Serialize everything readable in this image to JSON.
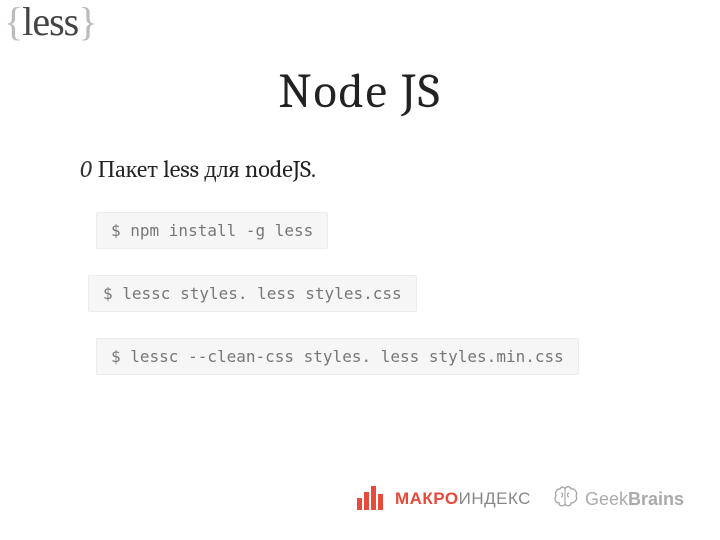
{
  "logo": {
    "brace_open": "{",
    "word": "less",
    "brace_close": "}"
  },
  "title": "Node JS",
  "bullet": {
    "marker": "0",
    "text": "Пакет less для nodeJS."
  },
  "code": {
    "line1": "$ npm install -g less",
    "line2": "$ lessc styles. less styles.css",
    "line3": "$ lessc --clean-css styles. less styles.min.css"
  },
  "footer": {
    "makro": {
      "part1": "МАКРО",
      "part2": "ИНДЕКС"
    },
    "geek": {
      "part1": "Geek",
      "part2": "Brains"
    }
  }
}
